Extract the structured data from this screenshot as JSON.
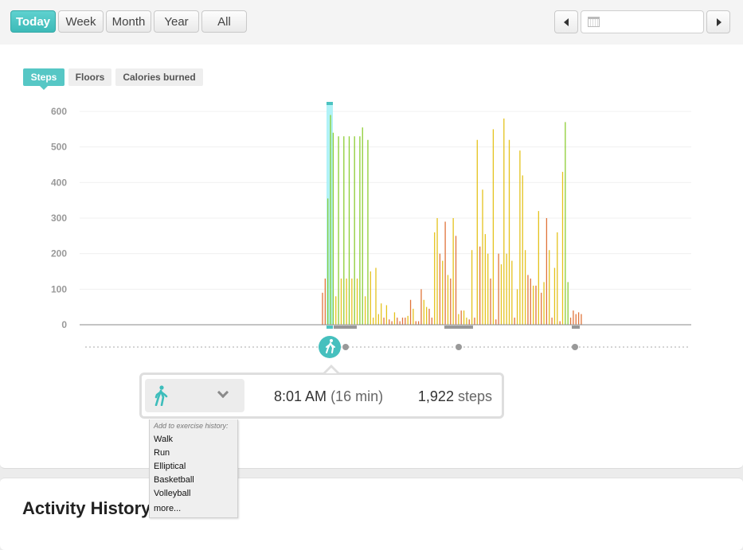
{
  "toolbar": {
    "ranges": [
      {
        "label": "Today",
        "active": true
      },
      {
        "label": "Week",
        "active": false
      },
      {
        "label": "Month",
        "active": false
      },
      {
        "label": "Year",
        "active": false
      },
      {
        "label": "All",
        "active": false
      }
    ],
    "date_value": "",
    "prev_icon": "caret-left-icon",
    "next_icon": "caret-right-icon",
    "calendar_icon": "calendar-icon"
  },
  "metric_tabs": [
    {
      "label": "Steps",
      "active": true
    },
    {
      "label": "Floors",
      "active": false
    },
    {
      "label": "Calories burned",
      "active": false
    }
  ],
  "colors": {
    "accent": "#4cc3c1",
    "low": "#e0743a",
    "mid": "#e4c21c",
    "high": "#8ccd33",
    "axis": "#999999"
  },
  "chart_data": {
    "type": "bar",
    "title": "",
    "xlabel": "",
    "ylabel": "",
    "ylim": [
      0,
      600
    ],
    "yticks": [
      0,
      100,
      200,
      300,
      400,
      500,
      600
    ],
    "grid": true,
    "x_unit": "minute-of-day",
    "selected_index": 14,
    "values": [
      90,
      130,
      355,
      590,
      540,
      80,
      530,
      130,
      530,
      130,
      530,
      130,
      530,
      130,
      530,
      555,
      80,
      520,
      150,
      20,
      160,
      30,
      60,
      20,
      55,
      15,
      10,
      35,
      20,
      10,
      20,
      20,
      25,
      70,
      45,
      10,
      10,
      100,
      70,
      50,
      45,
      20,
      260,
      300,
      200,
      180,
      290,
      140,
      130,
      300,
      250,
      30,
      40,
      40,
      20,
      15,
      210,
      20,
      520,
      220,
      380,
      255,
      200,
      130,
      550,
      15,
      200,
      170,
      580,
      200,
      520,
      180,
      20,
      100,
      490,
      420,
      210,
      140,
      130,
      110,
      110,
      320,
      90,
      120,
      300,
      210,
      20,
      160,
      260,
      10,
      430,
      570,
      120,
      20,
      40,
      30,
      35,
      30
    ],
    "bar_colors": [
      "low",
      "low",
      "high",
      "high",
      "high",
      "mid",
      "high",
      "mid",
      "high",
      "mid",
      "high",
      "mid",
      "high",
      "mid",
      "high",
      "high",
      "mid",
      "high",
      "mid",
      "mid",
      "mid",
      "mid",
      "mid",
      "low",
      "mid",
      "low",
      "low",
      "mid",
      "low",
      "low",
      "low",
      "low",
      "mid",
      "low",
      "mid",
      "low",
      "low",
      "low",
      "mid",
      "mid",
      "low",
      "low",
      "mid",
      "mid",
      "low",
      "mid",
      "low",
      "mid",
      "low",
      "mid",
      "low",
      "mid",
      "low",
      "mid",
      "mid",
      "low",
      "mid",
      "low",
      "mid",
      "low",
      "mid",
      "mid",
      "mid",
      "low",
      "mid",
      "low",
      "low",
      "mid",
      "mid",
      "mid",
      "mid",
      "mid",
      "low",
      "mid",
      "mid",
      "mid",
      "mid",
      "low",
      "low",
      "mid",
      "low",
      "mid",
      "low",
      "mid",
      "low",
      "mid",
      "low",
      "mid",
      "mid",
      "low",
      "mid",
      "high",
      "high",
      "low",
      "low",
      "low",
      "low",
      "low"
    ],
    "activity_markers": [
      {
        "type": "walk",
        "selected": true
      },
      {
        "type": "dot",
        "selected": false
      },
      {
        "type": "dot",
        "selected": false
      },
      {
        "type": "dot",
        "selected": false
      }
    ]
  },
  "popup": {
    "activity_icon": "walking-person-icon",
    "dropdown_icon": "chevron-down-icon",
    "time": "8:01 AM",
    "duration": "(16 min)",
    "steps_value": "1,922",
    "steps_unit": "steps"
  },
  "exercise_menu": {
    "title": "Add to exercise history:",
    "items": [
      "Walk",
      "Run",
      "Elliptical",
      "Basketball",
      "Volleyball",
      "more..."
    ]
  },
  "activity_history": {
    "title": "Activity History"
  }
}
